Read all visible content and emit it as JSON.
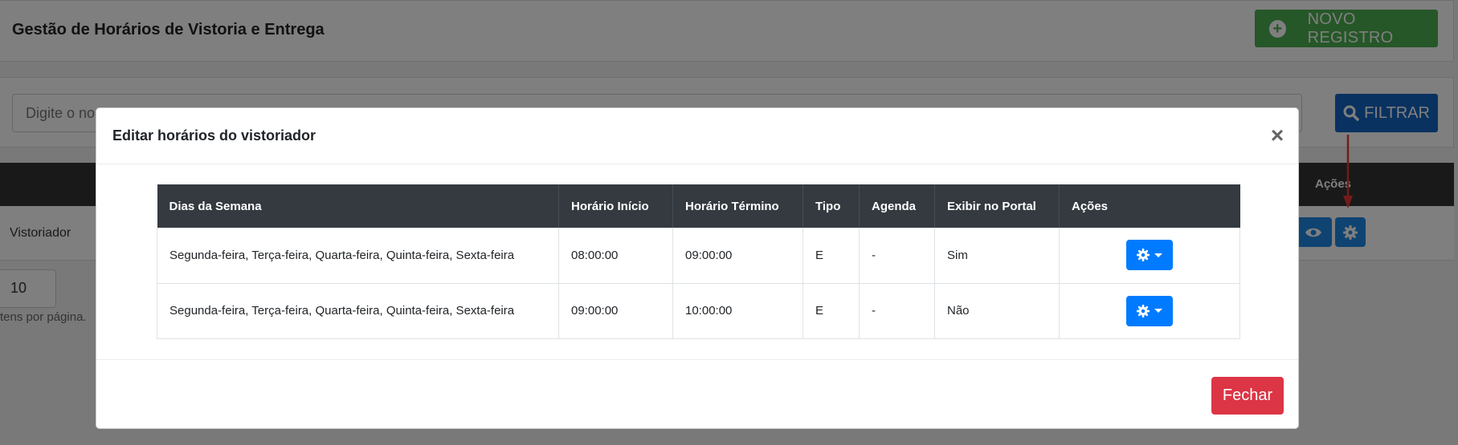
{
  "page": {
    "title": "Gestão de Horários de Vistoria e Entrega",
    "new_button_label": "NOVO REGISTRO",
    "search_placeholder": "Digite o no",
    "filter_button_label": "FILTRAR",
    "table": {
      "actions_header": "Ações",
      "row_label": "Vistoriador"
    },
    "per_page_value": "10",
    "per_page_label": "tens por página."
  },
  "modal": {
    "title": "Editar horários do vistoriador",
    "close_symbol": "×",
    "columns": [
      "Dias da Semana",
      "Horário Início",
      "Horário Término",
      "Tipo",
      "Agenda",
      "Exibir no Portal",
      "Ações"
    ],
    "rows": [
      {
        "dias": "Segunda-feira, Terça-feira, Quarta-feira, Quinta-feira, Sexta-feira",
        "inicio": "08:00:00",
        "termino": "09:00:00",
        "tipo": "E",
        "agenda": "-",
        "portal": "Sim"
      },
      {
        "dias": "Segunda-feira, Terça-feira, Quarta-feira, Quinta-feira, Sexta-feira",
        "inicio": "09:00:00",
        "termino": "10:00:00",
        "tipo": "E",
        "agenda": "-",
        "portal": "Não"
      }
    ],
    "footer_close_label": "Fechar"
  },
  "colors": {
    "primary": "#007bff",
    "success": "#4caf50",
    "danger": "#dc3545",
    "annotation_arrow": "#e53935"
  },
  "icons": {
    "new": "plus-circle-icon",
    "filter": "search-icon",
    "view": "eye-icon",
    "settings": "gear-icon",
    "dropdown": "caret-down-icon",
    "close": "close-icon"
  }
}
